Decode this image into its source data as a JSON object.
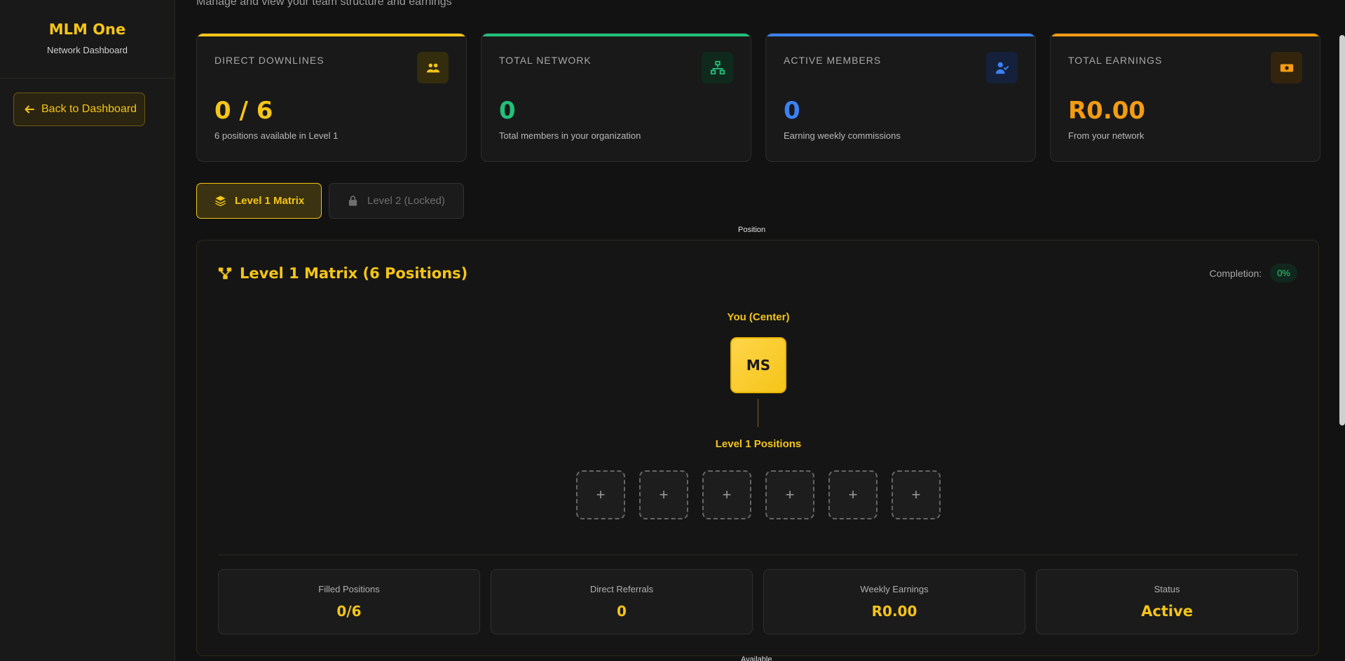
{
  "sidebar": {
    "brand_name": "MLM One",
    "brand_sub": "Network Dashboard",
    "back_button": "Back to Dashboard"
  },
  "header": {
    "subtitle": "Manage and view your team structure and earnings"
  },
  "stats": [
    {
      "label": "DIRECT DOWNLINES",
      "value": "0 / 6",
      "desc": "6 positions available in Level 1",
      "color": "#f5c518",
      "icon": "users-icon"
    },
    {
      "label": "TOTAL NETWORK",
      "value": "0",
      "desc": "Total members in your organization",
      "color": "#22c07a",
      "icon": "network-icon"
    },
    {
      "label": "ACTIVE MEMBERS",
      "value": "0",
      "desc": "Earning weekly commissions",
      "color": "#3b82f6",
      "icon": "user-check-icon"
    },
    {
      "label": "TOTAL EARNINGS",
      "value": "R0.00",
      "desc": "From your network",
      "color": "#f39c12",
      "icon": "money-icon"
    }
  ],
  "tabs": [
    {
      "label": "Level 1 Matrix",
      "active": true
    },
    {
      "label": "Level 2 (Locked)",
      "active": false
    }
  ],
  "hints": {
    "position_top": "Position",
    "position_bottom": "Available"
  },
  "matrix": {
    "title": "Level 1 Matrix (6 Positions)",
    "completion_label": "Completion:",
    "completion_value": "0%",
    "center_label": "You (Center)",
    "center_initials": "MS",
    "level_label": "Level 1 Positions",
    "slot_symbol": "+",
    "slots_total": 6
  },
  "summary": [
    {
      "label": "Filled Positions",
      "value": "0/6"
    },
    {
      "label": "Direct Referrals",
      "value": "0"
    },
    {
      "label": "Weekly Earnings",
      "value": "R0.00"
    },
    {
      "label": "Status",
      "value": "Active"
    }
  ]
}
